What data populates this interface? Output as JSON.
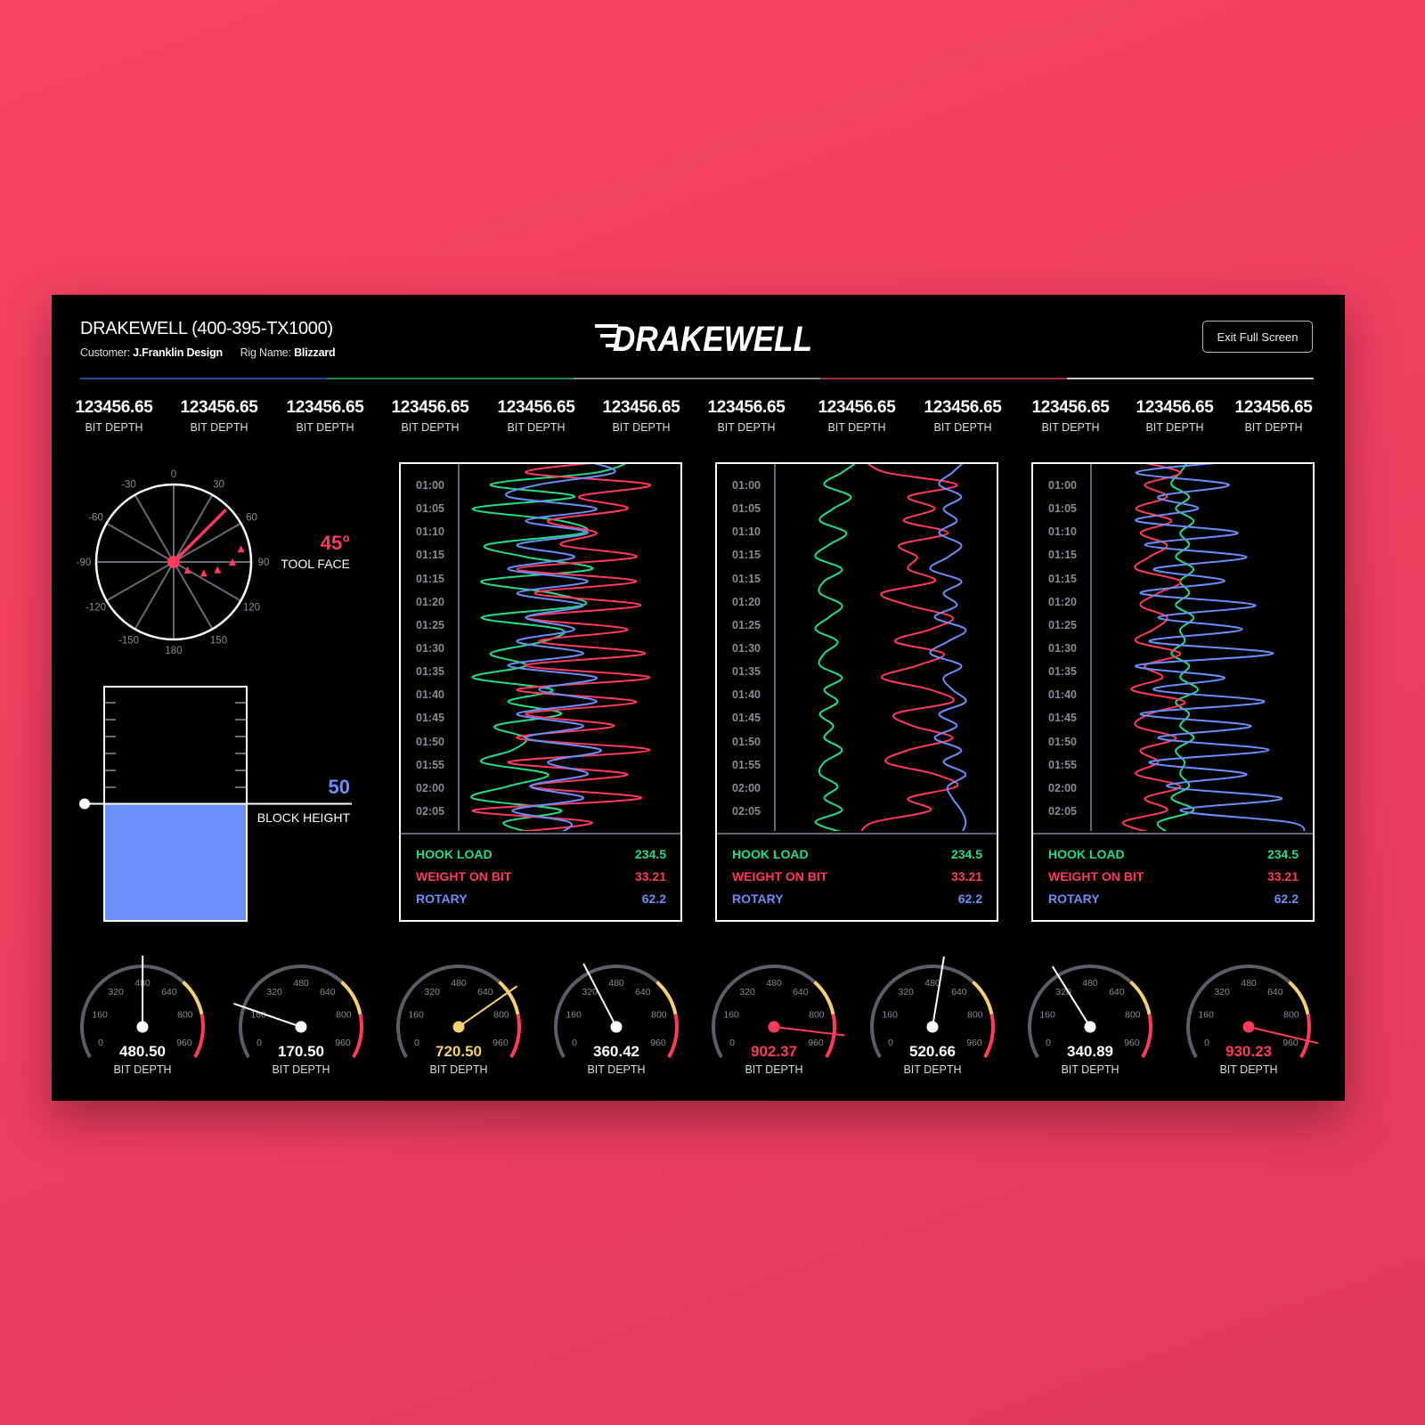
{
  "header": {
    "title": "DRAKEWELL (400-395-TX1000)",
    "customer_label": "Customer:",
    "customer": "J.Franklin Design",
    "rig_label": "Rig Name:",
    "rig": "Blizzard",
    "logo": "DRAKEWELL",
    "exit_button": "Exit Full Screen"
  },
  "stats": [
    {
      "value": "123456.65",
      "label": "BIT DEPTH"
    },
    {
      "value": "123456.65",
      "label": "BIT DEPTH"
    },
    {
      "value": "123456.65",
      "label": "BIT DEPTH"
    },
    {
      "value": "123456.65",
      "label": "BIT DEPTH"
    },
    {
      "value": "123456.65",
      "label": "BIT DEPTH"
    },
    {
      "value": "123456.65",
      "label": "BIT DEPTH"
    },
    {
      "value": "123456.65",
      "label": "BIT DEPTH"
    },
    {
      "value": "123456.65",
      "label": "BIT DEPTH"
    },
    {
      "value": "123456.65",
      "label": "BIT DEPTH"
    },
    {
      "value": "123456.65",
      "label": "BIT DEPTH"
    },
    {
      "value": "123456.65",
      "label": "BIT DEPTH"
    },
    {
      "value": "123456.65",
      "label": "BIT DEPTH"
    }
  ],
  "tool_face": {
    "value": "45°",
    "label": "TOOL FACE",
    "angle": 45,
    "history_angles": [
      79,
      90,
      100,
      110,
      120
    ],
    "ticks": [
      "0",
      "30",
      "60",
      "90",
      "120",
      "150",
      "180",
      "-150",
      "-120",
      "-90",
      "-60",
      "-30"
    ]
  },
  "block_height": {
    "value": "50",
    "label": "BLOCK HEIGHT",
    "fill_percent": 50
  },
  "colors": {
    "hook_load": "#22dd88",
    "weight_on_bit": "#ff3a5c",
    "rotary": "#6a8ff8",
    "warning": "#f5d070",
    "danger": "#ff3a5c",
    "track": "#5c5c6a",
    "fill": "#6a8ff8"
  },
  "chart_times": [
    "01:00",
    "01:05",
    "01:10",
    "01:15",
    "01:15",
    "01:20",
    "01:25",
    "01:30",
    "01:35",
    "01:40",
    "01:45",
    "01:50",
    "01:55",
    "02:00",
    "02:05"
  ],
  "panels": [
    {
      "readouts": [
        {
          "label": "HOOK LOAD",
          "value": "234.5"
        },
        {
          "label": "WEIGHT ON BIT",
          "value": "33.21"
        },
        {
          "label": "ROTARY",
          "value": "62.2"
        }
      ],
      "series": {
        "hook_load": [
          78,
          62,
          14,
          52,
          6,
          46,
          56,
          12,
          30,
          60,
          10,
          42,
          56,
          10,
          46,
          38,
          14,
          30,
          6,
          42,
          22,
          46,
          16,
          30,
          24,
          10,
          40,
          22,
          6,
          46,
          20,
          36
        ],
        "weight_on_bit": [
          72,
          30,
          86,
          54,
          76,
          40,
          62,
          46,
          80,
          26,
          80,
          34,
          82,
          30,
          76,
          36,
          84,
          30,
          86,
          26,
          80,
          30,
          70,
          26,
          86,
          22,
          76,
          32,
          82,
          6,
          60,
          12
        ],
        "rotary": [
          56,
          70,
          36,
          22,
          62,
          30,
          58,
          26,
          52,
          22,
          58,
          26,
          56,
          30,
          52,
          26,
          56,
          22,
          62,
          36,
          62,
          26,
          56,
          30,
          64,
          40,
          58,
          32,
          56,
          24,
          50,
          44
        ]
      }
    },
    {
      "readouts": [
        {
          "label": "HOOK LOAD",
          "value": "234.5"
        },
        {
          "label": "WEIGHT ON BIT",
          "value": "33.21"
        },
        {
          "label": "ROTARY",
          "value": "62.2"
        }
      ],
      "series": {
        "hook_load": [
          38,
          30,
          22,
          34,
          26,
          20,
          32,
          24,
          18,
          30,
          22,
          20,
          30,
          24,
          18,
          28,
          22,
          20,
          30,
          22,
          28,
          20,
          26,
          22,
          30,
          22,
          20,
          28,
          22,
          30,
          18,
          34
        ],
        "weight_on_bit": [
          40,
          50,
          82,
          60,
          72,
          58,
          78,
          56,
          64,
          60,
          72,
          48,
          60,
          80,
          70,
          54,
          76,
          64,
          48,
          70,
          80,
          54,
          62,
          80,
          60,
          50,
          72,
          82,
          60,
          70,
          44,
          38
        ],
        "rotary": [
          86,
          80,
          74,
          84,
          76,
          82,
          74,
          84,
          78,
          70,
          84,
          76,
          82,
          72,
          86,
          78,
          70,
          84,
          76,
          80,
          86,
          74,
          82,
          72,
          84,
          76,
          86,
          78,
          80,
          84,
          86,
          84
        ]
      }
    },
    {
      "readouts": [
        {
          "label": "HOOK LOAD",
          "value": "234.5"
        },
        {
          "label": "WEIGHT ON BIT",
          "value": "33.21"
        },
        {
          "label": "ROTARY",
          "value": "62.2"
        }
      ],
      "series": {
        "hook_load": [
          44,
          40,
          36,
          44,
          38,
          46,
          40,
          44,
          38,
          46,
          40,
          44,
          38,
          46,
          40,
          42,
          36,
          44,
          40,
          48,
          38,
          44,
          40,
          46,
          38,
          42,
          40,
          44,
          36,
          46,
          30,
          36
        ],
        "weight_on_bit": [
          18,
          40,
          24,
          34,
          20,
          36,
          22,
          34,
          26,
          20,
          40,
          30,
          22,
          34,
          28,
          20,
          40,
          24,
          32,
          18,
          42,
          26,
          20,
          38,
          22,
          30,
          20,
          40,
          24,
          34,
          14,
          30
        ],
        "rotary": [
          70,
          20,
          62,
          30,
          48,
          20,
          66,
          24,
          70,
          28,
          60,
          22,
          74,
          30,
          68,
          26,
          82,
          20,
          60,
          28,
          78,
          22,
          72,
          30,
          80,
          26,
          70,
          34,
          86,
          40,
          90,
          96
        ]
      }
    }
  ],
  "gauges": [
    {
      "value": "480.50",
      "number": 480.5,
      "label": "BIT DEPTH",
      "status": "normal"
    },
    {
      "value": "170.50",
      "number": 170.5,
      "label": "BIT DEPTH",
      "status": "normal"
    },
    {
      "value": "720.50",
      "number": 720.5,
      "label": "BIT DEPTH",
      "status": "warning"
    },
    {
      "value": "360.42",
      "number": 360.42,
      "label": "BIT DEPTH",
      "status": "normal"
    },
    {
      "value": "902.37",
      "number": 902.37,
      "label": "BIT DEPTH",
      "status": "danger"
    },
    {
      "value": "520.66",
      "number": 520.66,
      "label": "BIT DEPTH",
      "status": "normal"
    },
    {
      "value": "340.89",
      "number": 340.89,
      "label": "BIT DEPTH",
      "status": "normal"
    },
    {
      "value": "930.23",
      "number": 930.23,
      "label": "BIT DEPTH",
      "status": "danger"
    }
  ],
  "gauge_ticks": [
    "0",
    "160",
    "320",
    "480",
    "640",
    "800",
    "960"
  ]
}
